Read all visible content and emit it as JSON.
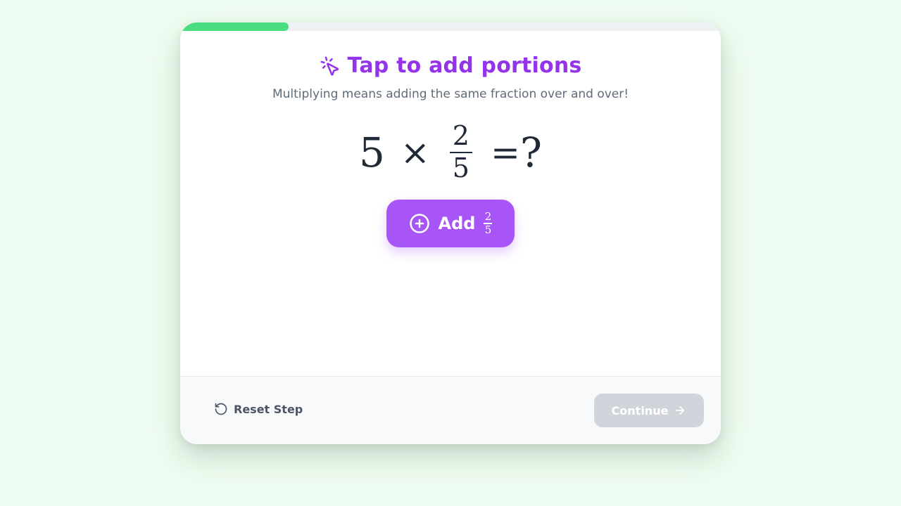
{
  "progress": {
    "fraction": 0.2
  },
  "header": {
    "title": "Tap to add portions",
    "title_icon": "pointer-click-icon",
    "subtitle": "Multiplying means adding the same fraction over and over!"
  },
  "equation": {
    "multiplier": "5",
    "times": "×",
    "fraction": {
      "numerator": "2",
      "denominator": "5"
    },
    "equals": "=",
    "result": "?"
  },
  "add_button": {
    "label": "Add",
    "icon": "plus-circle-icon",
    "fraction": {
      "numerator": "2",
      "denominator": "5"
    }
  },
  "footer": {
    "reset_label": "Reset Step",
    "reset_icon": "rotate-ccw-icon",
    "continue_label": "Continue",
    "continue_icon": "arrow-right-icon"
  },
  "colors": {
    "accent": "#a855f7",
    "title": "#9333ea",
    "progress": "#4ade80",
    "disabled": "#d1d5db"
  }
}
